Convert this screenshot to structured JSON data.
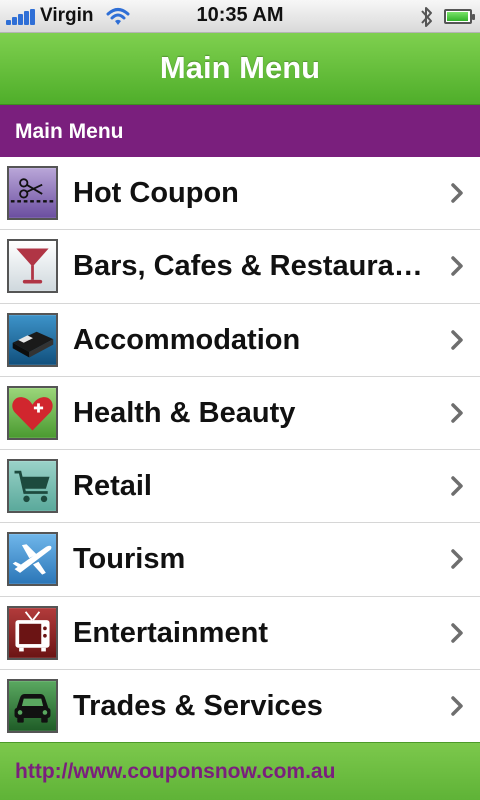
{
  "status_bar": {
    "carrier": "Virgin",
    "time": "10:35 AM",
    "battery_level": 0.95
  },
  "nav_bar": {
    "title": "Main Menu"
  },
  "section_header": {
    "title": "Main Menu"
  },
  "menu": {
    "items": [
      {
        "label": "Hot Coupon",
        "icon": "scissors-coupon-icon"
      },
      {
        "label": "Bars, Cafes & Restaura…",
        "icon": "cocktail-glass-icon"
      },
      {
        "label": "Accommodation",
        "icon": "bed-icon"
      },
      {
        "label": "Health & Beauty",
        "icon": "heart-icon"
      },
      {
        "label": "Retail",
        "icon": "shopping-cart-icon"
      },
      {
        "label": "Tourism",
        "icon": "airplane-icon"
      },
      {
        "label": "Entertainment",
        "icon": "television-icon"
      },
      {
        "label": "Trades & Services",
        "icon": "car-icon"
      }
    ]
  },
  "footer": {
    "link_text": "http://www.couponsnow.com.au"
  },
  "colors": {
    "accent_green": "#5fb337",
    "accent_purple": "#7a1f7d"
  }
}
